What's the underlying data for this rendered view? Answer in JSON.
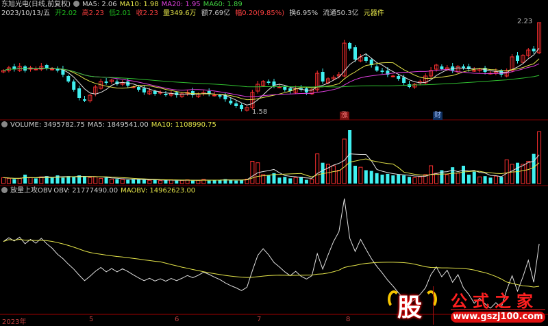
{
  "header": {
    "stock_name": "东旭光电(日线,前复权)",
    "ma5": "MA5: 2.06",
    "ma10": "MA10: 1.98",
    "ma20": "MA20: 1.95",
    "ma60": "MA60: 1.89",
    "date": "2023/10/13/五",
    "open_label": "开",
    "open": "2.02",
    "high_label": "高",
    "high": "2.23",
    "low_label": "低",
    "low": "2.01",
    "close_label": "收",
    "close": "2.23",
    "vol_label": "量",
    "vol": "349.6万",
    "amount": "额7.69亿",
    "change_label": "幅",
    "change": "0.20(9.85%)",
    "turnover": "换6.95%",
    "float": "流通50.3亿",
    "sector": "元器件"
  },
  "volume_header": {
    "volume": "VOLUME: 3495782.75",
    "ma5": "MA5: 1849541.00",
    "ma10": "MA10: 1108990.75"
  },
  "obv_header": {
    "name": "放量上攻OBV",
    "obv": "OBV: 21777490.00",
    "maobv": "MAOBV: 14962623.00"
  },
  "annotations": {
    "high": "2.23",
    "low": "1.58",
    "tag1": "涨",
    "tag2": "财"
  },
  "x_axis": [
    "2023年",
    "5",
    "6",
    "7",
    "8"
  ],
  "logo": {
    "char": "股",
    "title": "公式之家",
    "url": "www.gszj100.com"
  },
  "colors": {
    "up": "#ff3030",
    "down": "#40f0f0",
    "ma5": "#e0e0e0",
    "ma10": "#e6e64a",
    "ma20": "#e040e0",
    "ma60": "#30c030"
  },
  "chart_data": {
    "type": "candlestick",
    "price_range": [
      1.58,
      2.23
    ],
    "close": [
      1.88,
      1.9,
      1.89,
      1.91,
      1.88,
      1.9,
      1.89,
      1.91,
      1.9,
      1.89,
      1.88,
      1.85,
      1.8,
      1.74,
      1.68,
      1.66,
      1.7,
      1.76,
      1.8,
      1.79,
      1.81,
      1.78,
      1.79,
      1.77,
      1.76,
      1.74,
      1.72,
      1.73,
      1.71,
      1.72,
      1.7,
      1.71,
      1.7,
      1.71,
      1.72,
      1.7,
      1.71,
      1.72,
      1.71,
      1.7,
      1.69,
      1.67,
      1.64,
      1.62,
      1.6,
      1.61,
      1.72,
      1.78,
      1.8,
      1.79,
      1.77,
      1.76,
      1.74,
      1.73,
      1.75,
      1.74,
      1.72,
      1.74,
      1.86,
      1.8,
      1.82,
      1.83,
      1.85,
      2.08,
      2.04,
      1.96,
      1.98,
      1.95,
      1.92,
      1.88,
      1.87,
      1.85,
      1.84,
      1.82,
      1.79,
      1.76,
      1.78,
      1.8,
      1.84,
      1.88,
      1.92,
      1.89,
      1.9,
      1.88,
      1.91,
      1.9,
      1.89,
      1.88,
      1.89,
      1.87,
      1.86,
      1.87,
      1.85,
      1.88,
      1.98,
      1.95,
      1.99,
      2.03,
      2.02,
      2.23
    ],
    "volume_wan": [
      40,
      35,
      30,
      35,
      60,
      40,
      35,
      45,
      50,
      40,
      55,
      40,
      50,
      45,
      55,
      50,
      40,
      45,
      35,
      40,
      30,
      30,
      28,
      25,
      30,
      28,
      25,
      22,
      25,
      20,
      22,
      25,
      20,
      22,
      25,
      20,
      22,
      28,
      20,
      25,
      22,
      30,
      25,
      20,
      25,
      30,
      150,
      140,
      60,
      55,
      70,
      40,
      45,
      35,
      40,
      45,
      25,
      30,
      200,
      140,
      130,
      120,
      90,
      300,
      360,
      120,
      110,
      90,
      85,
      70,
      60,
      65,
      55,
      60,
      55,
      45,
      40,
      45,
      60,
      120,
      70,
      90,
      60,
      110,
      70,
      120,
      60,
      80,
      45,
      50,
      40,
      50,
      45,
      160,
      130,
      140,
      130,
      150,
      200,
      349.58
    ]
  }
}
